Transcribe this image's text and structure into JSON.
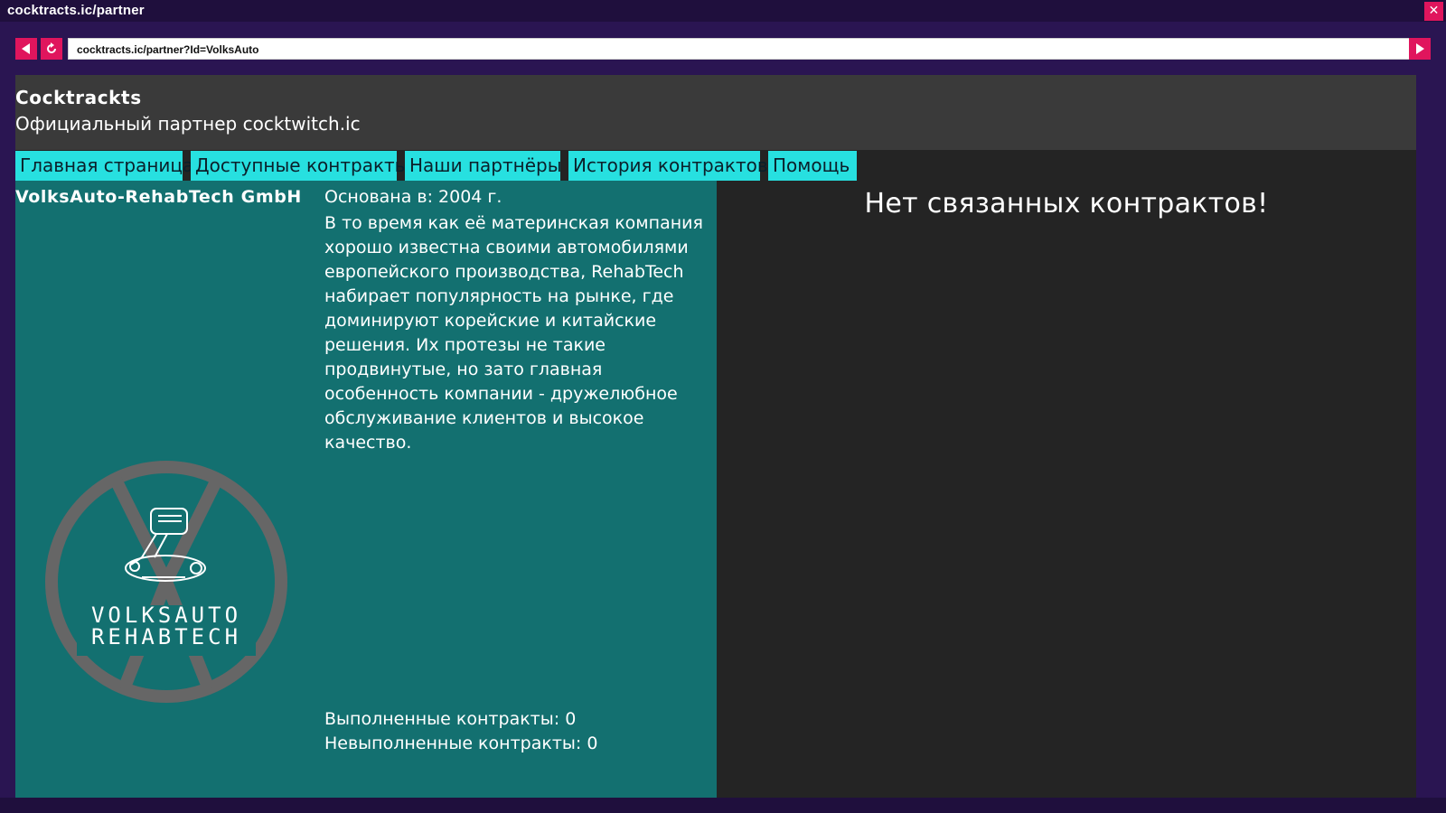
{
  "window": {
    "title": "cocktracts.ic/partner"
  },
  "browser": {
    "address": "cocktracts.ic/partner?Id=VolksAuto"
  },
  "site": {
    "brand": "Cocktrackts",
    "tagline": "Официальный партнер cocktwitch.ic"
  },
  "tabs": [
    {
      "label": "Главная страница"
    },
    {
      "label": "Доступные контракты"
    },
    {
      "label": "Наши партнёры"
    },
    {
      "label": "История контрактов"
    },
    {
      "label": "Помощь"
    }
  ],
  "partner": {
    "name": "VolksAuto-RehabTech GmbH",
    "founded": "Основана в: 2004 г.",
    "description": "В то время как её материнская компания хорошо известна своими автомобилями европейского производства, RehabTech набирает популярность на рынке, где доминируют корейские и китайские решения. Их протезы не такие продвинутые, но зато главная особенность компании - дружелюбное обслуживание клиентов и высокое качество.",
    "completed": "Выполненные контракты: 0",
    "failed": "Невыполненные контракты: 0",
    "logo_text_line1": "VOLKSAUTO",
    "logo_text_line2": "REHABTECH"
  },
  "contracts": {
    "empty_message": "Нет связанных контрактов!"
  },
  "colors": {
    "accent": "#e0155d",
    "tab": "#27e0e0",
    "panel": "#137070",
    "page": "#242424",
    "header": "#3a3a3a"
  },
  "icons": {
    "back": "back-arrow-icon",
    "reload": "reload-icon",
    "forward": "forward-arrow-icon",
    "close": "close-icon"
  }
}
